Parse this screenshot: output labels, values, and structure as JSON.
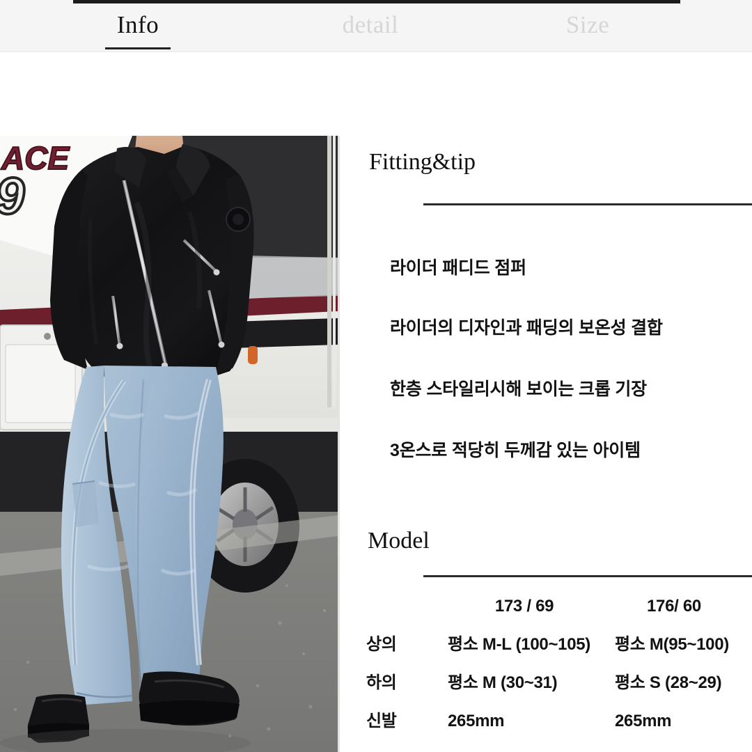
{
  "tabs": [
    {
      "label": "Info",
      "state": "active"
    },
    {
      "label": "detail",
      "state": "inactive"
    },
    {
      "label": "Size",
      "state": "inactive"
    }
  ],
  "photo": {
    "alt_description": "Model wearing black rider padded jumper and light wash wide denim jeans standing in front of a white bus",
    "background_text": "ACE 9"
  },
  "fitting": {
    "title": "Fitting&tip",
    "lines": [
      "라이더 패디드 점퍼",
      "라이더의 디자인과 패딩의 보온성 결합",
      "한층 스타일리시해 보이는 크롭 기장",
      "3온스로 적당히 두께감 있는 아이템"
    ]
  },
  "model": {
    "title": "Model",
    "columns": [
      "173 / 69",
      "176/ 60"
    ],
    "rows": [
      {
        "label": "상의",
        "values": [
          "평소 M-L (100~105)",
          "평소 M(95~100)"
        ]
      },
      {
        "label": "하의",
        "values": [
          "평소 M (30~31)",
          "평소 S (28~29)"
        ]
      },
      {
        "label": "신발",
        "values": [
          "265mm",
          "265mm"
        ]
      }
    ]
  },
  "colors": {
    "tabbar_bg": "#f5f5f5",
    "tab_active": "#121212",
    "tab_inactive": "#d6d6d6",
    "rule": "#2b2b2b",
    "text": "#121212",
    "page_bg": "#ffffff"
  }
}
